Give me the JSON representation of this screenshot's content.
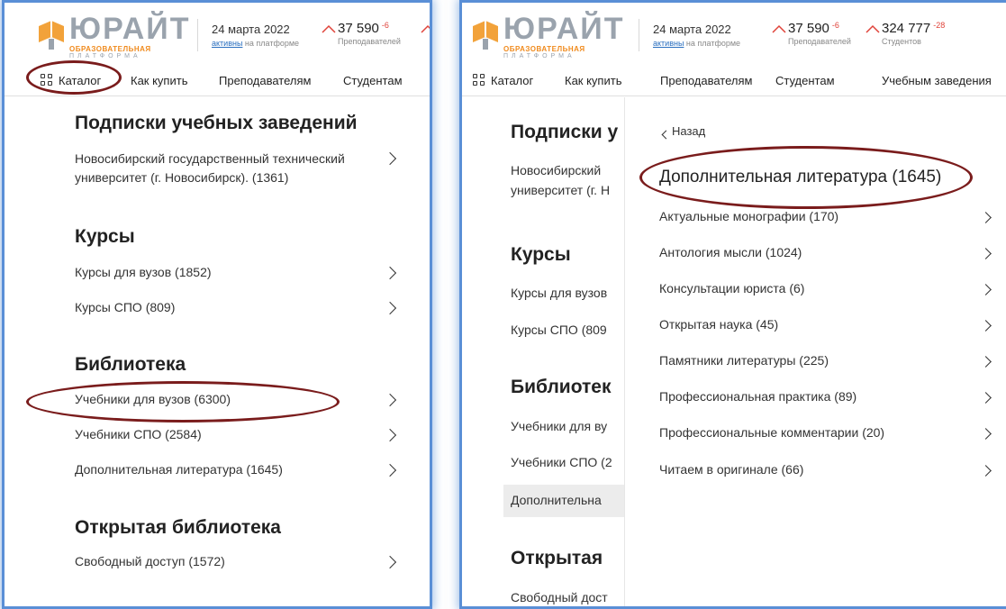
{
  "header": {
    "logo_word": "ЮРАЙТ",
    "logo_sub1": "ОБРАЗОВАТЕЛЬНАЯ",
    "logo_sub2": "ПЛАТФОРМА",
    "date": "24 марта 2022",
    "date_sub_link": "активны",
    "date_sub_rest": " на платформе",
    "teachers_count": "37 590",
    "teachers_delta": "-6",
    "teachers_label": "Преподавателей",
    "students_count": "324 777",
    "students_delta": "-28",
    "students_label": "Студентов"
  },
  "nav": {
    "catalog": "Каталог",
    "how_to_buy": "Как купить",
    "teachers": "Преподавателям",
    "students": "Студентам",
    "institutions": "Учебным заведения"
  },
  "left_panel": {
    "section_subscriptions": "Подписки учебных заведений",
    "university_name": "Новосибирский государственный технический университет (г. Новосибирск). (1361)",
    "section_courses": "Курсы",
    "courses": [
      "Курсы для вузов (1852)",
      "Курсы СПО (809)"
    ],
    "section_library": "Библиотека",
    "library": [
      "Учебники для вузов (6300)",
      "Учебники СПО (2584)",
      "Дополнительная литература (1645)"
    ],
    "section_open_library": "Открытая библиотека",
    "open_library": [
      "Свободный доступ (1572)"
    ]
  },
  "right_panel": {
    "bg_subscriptions": "Подписки у",
    "bg_university_line1": "Новосибирский",
    "bg_university_line2": "университет (г. Н",
    "bg_courses": "Курсы",
    "bg_course1": "Курсы для вузов",
    "bg_course2": "Курсы СПО (809",
    "bg_library": "Библиотек",
    "bg_lib1": "Учебники для ву",
    "bg_lib2": "Учебники СПО (2",
    "bg_lib3": "Дополнительна",
    "bg_open": "Открытая",
    "bg_open1": "Свободный дост",
    "submenu": {
      "back": "Назад",
      "title": "Дополнительная литература (1645)",
      "items": [
        "Актуальные монографии (170)",
        "Антология мысли (1024)",
        "Консультации юриста (6)",
        "Открытая наука (45)",
        "Памятники литературы (225)",
        "Профессиональная практика (89)",
        "Профессиональные комментарии (20)",
        "Читаем в оригинале (66)"
      ]
    }
  },
  "colors": {
    "annotation_oval": "#7a1c1c",
    "panel_border": "#5a8fd6",
    "brand_orange": "#f08a1c",
    "delta_red": "#e0433a"
  }
}
